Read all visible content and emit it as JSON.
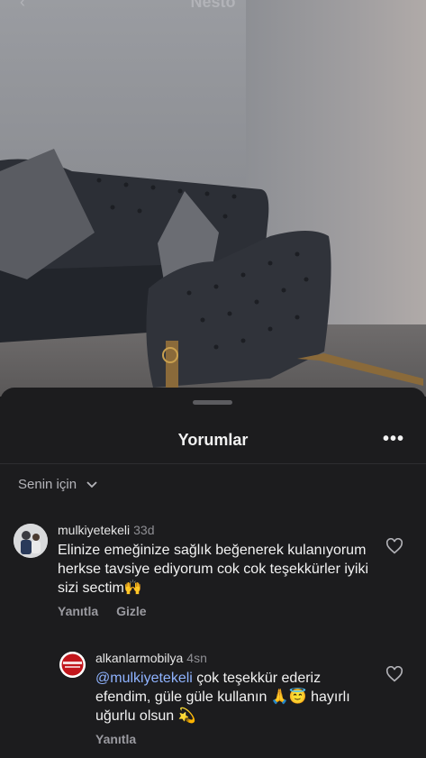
{
  "photo": {
    "title": "Nesto",
    "back_icon": "chevron-left-icon"
  },
  "sheet": {
    "title": "Yorumlar",
    "more_icon": "more-horizontal-icon",
    "filter_label": "Senin için",
    "filter_icon": "chevron-down-icon"
  },
  "comments": [
    {
      "username": "mulkiyetekeli",
      "time": "33d",
      "text": "Elinize emeğinize sağlık beğenerek kulanıyorum  herkse  tavsiye ediyorum  cok cok teşekkürler  iyiki sizi sectim🙌",
      "reply_label": "Yanıtla",
      "hide_label": "Gizle"
    },
    {
      "username": "alkanlarmobilya",
      "time": "4sn",
      "mention": "@mulkiyetekeli",
      "text": " çok teşekkür ederiz efendim, güle güle kullanın 🙏😇 hayırlı uğurlu olsun 💫",
      "reply_label": "Yanıtla",
      "avatar_logo_text": "ALKANLAR MOBİLYA"
    }
  ],
  "colors": {
    "background": "#1c1c1e",
    "mention": "#8fb3ff",
    "muted": "#9a9aa0"
  }
}
